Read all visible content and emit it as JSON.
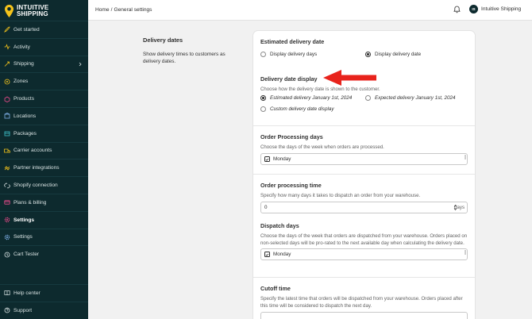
{
  "brand": {
    "line1": "INTUITIVE",
    "line2": "SHIPPING",
    "pin_color": "#f4c31b"
  },
  "sidebar": {
    "items": [
      {
        "label": "Get started",
        "icon": "rocket-icon"
      },
      {
        "label": "Activity",
        "icon": "activity-icon"
      },
      {
        "label": "Shipping",
        "icon": "shipping-icon"
      },
      {
        "label": "Zones",
        "icon": "zones-icon"
      },
      {
        "label": "Products",
        "icon": "products-icon"
      },
      {
        "label": "Locations",
        "icon": "locations-icon"
      },
      {
        "label": "Packages",
        "icon": "packages-icon"
      },
      {
        "label": "Carrier accounts",
        "icon": "carrier-icon"
      },
      {
        "label": "Partner integrations",
        "icon": "partner-icon"
      },
      {
        "label": "Shopify connection",
        "icon": "shopify-icon"
      },
      {
        "label": "Plans & billing",
        "icon": "billing-icon"
      },
      {
        "label": "Settings",
        "icon": "settings-icon"
      },
      {
        "label": "Settings",
        "icon": "settings-icon"
      },
      {
        "label": "Cart Tester",
        "icon": "cart-icon"
      }
    ],
    "bottom": [
      {
        "label": "Help center",
        "icon": "help-icon"
      },
      {
        "label": "Support",
        "icon": "support-icon"
      }
    ]
  },
  "topbar": {
    "breadcrumb_home": "Home",
    "breadcrumb_sep": "/",
    "breadcrumb_current": "General settings",
    "avatar_initials": "IS",
    "user_name": "Intuitive Shipping"
  },
  "section": {
    "title": "Delivery dates",
    "description": "Show delivery times to customers as delivery dates."
  },
  "card": {
    "estimated": {
      "title": "Estimated delivery date",
      "option_days": "Display delivery days",
      "option_date": "Display delivery date",
      "selected": "date"
    },
    "display": {
      "title": "Delivery date display",
      "subtitle": "Choose how the delivery date is shown to the customer.",
      "option1": "Estimated delivery January 1st, 2024",
      "option2": "Expected delivery January 1st, 2024",
      "option3": "Custom delivery date display"
    },
    "processing_days": {
      "title": "Order Processing days",
      "subtitle": "Choose the days of the week when orders are processed.",
      "value": "Monday"
    },
    "processing_time": {
      "title": "Order processing time",
      "subtitle": "Specify how many days it takes to dispatch an order from your warehouse.",
      "value": "0",
      "suffix": "days"
    },
    "dispatch_days": {
      "title": "Dispatch days",
      "subtitle": "Choose the days of the week that orders are dispatched from your warehouse. Orders placed on non-selected days will be pro-rated to the next available day when calculating the delivery date.",
      "value": "Monday"
    },
    "cutoff": {
      "title": "Cutoff time",
      "subtitle": "Specify the latest time that orders will be dispatched from your warehouse. Orders placed after this time will be considered to dispatch the next day."
    }
  },
  "colors": {
    "sidebar_bg": "#0d2a2e",
    "arrow": "#e8231c",
    "accent": "#303030"
  }
}
